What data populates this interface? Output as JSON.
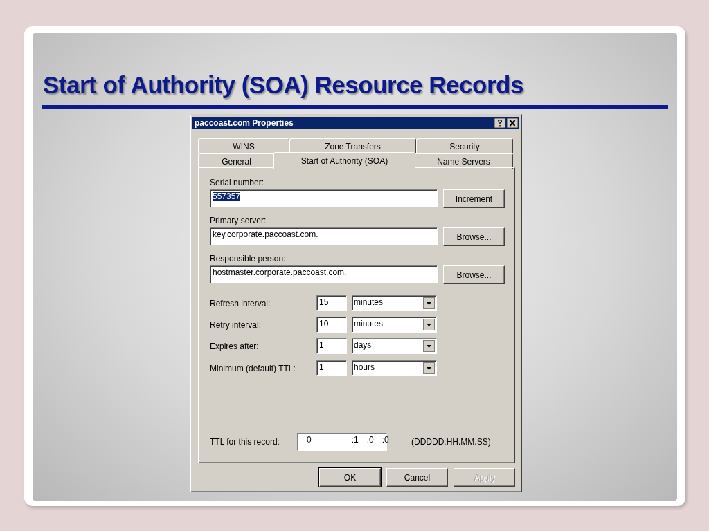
{
  "slide": {
    "title": "Start of Authority (SOA) Resource Records"
  },
  "dialog": {
    "title": "paccoast.com Properties",
    "tab_rows": [
      [
        {
          "label": "WINS",
          "selected": false
        },
        {
          "label": "Zone Transfers",
          "selected": false
        },
        {
          "label": "Security",
          "selected": false
        }
      ],
      [
        {
          "label": "General",
          "selected": false
        },
        {
          "label": "Start of Authority (SOA)",
          "selected": true
        },
        {
          "label": "Name Servers",
          "selected": false
        }
      ]
    ],
    "fields": [
      {
        "label": "Serial number:",
        "value": "557357",
        "value_selected": true,
        "button": "Increment"
      },
      {
        "label": "Primary server:",
        "value": "key.corporate.paccoast.com.",
        "value_selected": false,
        "button": "Browse..."
      },
      {
        "label": "Responsible person:",
        "value": "hostmaster.corporate.paccoast.com.",
        "value_selected": false,
        "button": "Browse..."
      }
    ],
    "intervals": [
      {
        "label": "Refresh interval:",
        "value": "15",
        "unit": "minutes"
      },
      {
        "label": "Retry interval:",
        "value": "10",
        "unit": "minutes"
      },
      {
        "label": "Expires after:",
        "value": "1",
        "unit": "days"
      },
      {
        "label": "Minimum (default) TTL:",
        "value": "1",
        "unit": "hours"
      }
    ],
    "ttl": {
      "label": "TTL for this record:",
      "parts": [
        "0",
        ":1",
        ":0",
        ":0"
      ],
      "format": "(DDDDD:HH.MM.SS)"
    },
    "buttons": [
      {
        "label": "OK",
        "default": true,
        "disabled": false
      },
      {
        "label": "Cancel",
        "default": false,
        "disabled": false
      },
      {
        "label": "Apply",
        "default": false,
        "disabled": true
      }
    ]
  }
}
